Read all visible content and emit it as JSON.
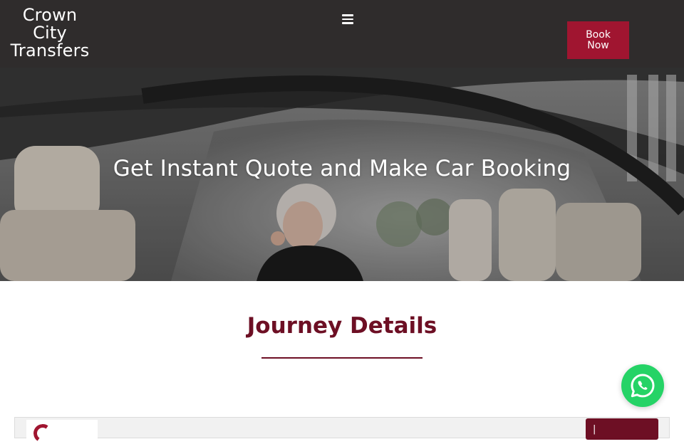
{
  "header": {
    "logo_text": "Crown\nCity\nTransfers",
    "book_button_label": "Book\nNow",
    "colors": {
      "background": "#2f2c2c",
      "accent": "#a01530"
    }
  },
  "hero": {
    "title": "Get Instant Quote and Make Car Booking"
  },
  "journey": {
    "title": "Journey Details",
    "color": "#6d0f24"
  },
  "floating": {
    "whatsapp_icon": "whatsapp-icon",
    "color": "#25d366"
  },
  "widget": {
    "button_label": "|"
  }
}
